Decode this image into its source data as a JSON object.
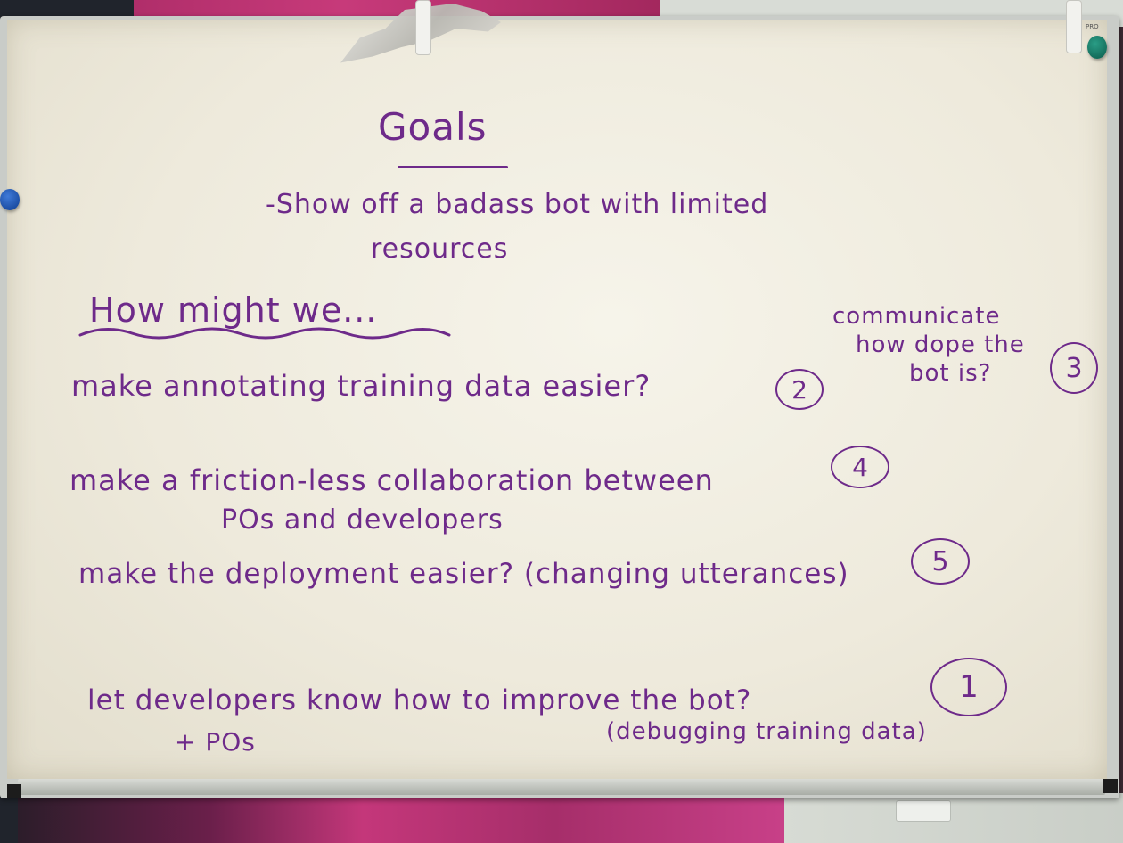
{
  "board": {
    "brand": "PRO",
    "title": "Goals",
    "goal_line_1": "-Show off a badass bot with limited",
    "goal_line_2": "resources",
    "hmw_heading": "How might we...",
    "items": [
      {
        "text": "make annotating training data easier?",
        "rank": "2"
      },
      {
        "text_line_1": "communicate",
        "text_line_2": "how dope the",
        "text_line_3": "bot is?",
        "rank": "3"
      },
      {
        "text_line_1": "make a friction-less collaboration between",
        "text_line_2": "POs and developers",
        "rank": "4"
      },
      {
        "text": "make the deployment easier? (changing utterances)",
        "rank": "5"
      },
      {
        "text_line_1": "let developers know how to improve the bot?",
        "text_line_2": "+ POs",
        "text_line_3": "(debugging training data)",
        "rank": "1"
      }
    ]
  },
  "colors": {
    "marker": "#6e2a8a",
    "board": "#f3f1e6",
    "curtain": "#c4377a"
  }
}
